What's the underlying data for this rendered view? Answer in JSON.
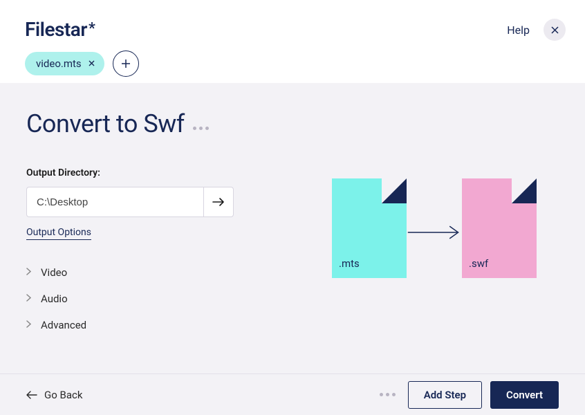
{
  "header": {
    "logo": "Filestar",
    "help": "Help"
  },
  "chips": [
    {
      "label": "video.mts"
    }
  ],
  "main": {
    "title": "Convert to Swf",
    "output_dir_label": "Output Directory:",
    "output_dir_value": "C:\\Desktop",
    "output_options": "Output Options",
    "accordion": [
      {
        "label": "Video"
      },
      {
        "label": "Audio"
      },
      {
        "label": "Advanced"
      }
    ],
    "illo": {
      "from_ext": ".mts",
      "to_ext": ".swf"
    }
  },
  "footer": {
    "go_back": "Go Back",
    "add_step": "Add Step",
    "convert": "Convert"
  }
}
